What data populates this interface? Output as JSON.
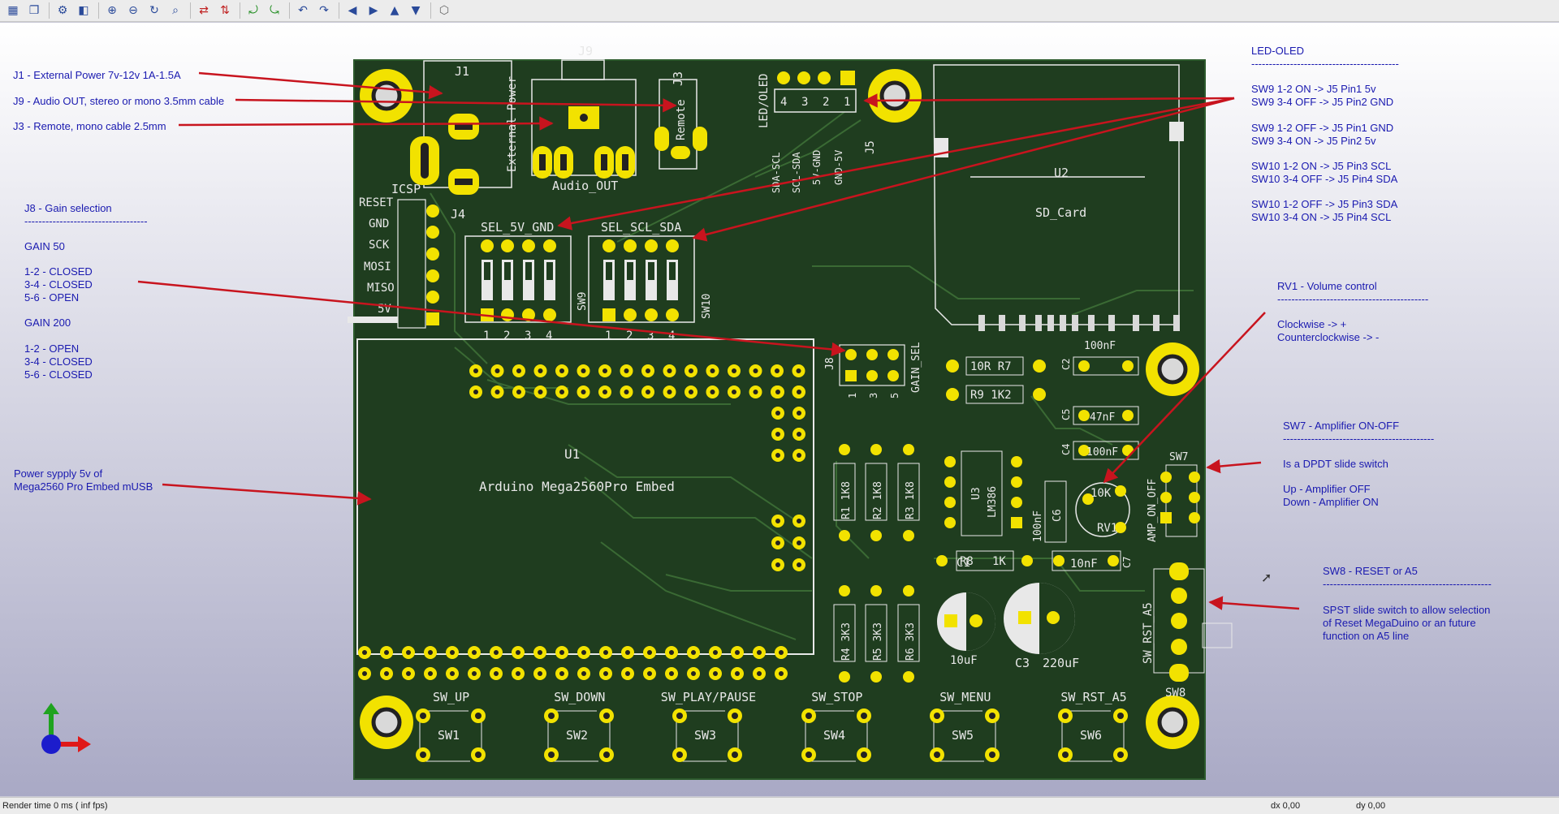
{
  "toolbar": {
    "icons": [
      "board-setup-icon",
      "layers-icon",
      "preferences-icon",
      "3d-box-icon",
      "zoom-in-icon",
      "zoom-out-icon",
      "redraw-icon",
      "zoom-fit-icon",
      "flip-x-icon",
      "flip-y-icon",
      "rotate-x-icon",
      "rotate-y-icon",
      "rotate-z-icon",
      "rotate-z-ccw-icon",
      "move-left-icon",
      "move-right-icon",
      "move-up-icon",
      "move-down-icon",
      "ortho-icon"
    ]
  },
  "annotations": {
    "j1": "J1 - External Power 7v-12v 1A-1.5A",
    "j9": "J9 - Audio OUT, stereo or mono 3.5mm cable",
    "j3": "J3 - Remote, mono cable 2.5mm",
    "j8_title": "J8 - Gain selection",
    "j8_rule": "-----------------------------------",
    "gain50": "GAIN 50",
    "gain50_l1": "1-2 - CLOSED",
    "gain50_l2": "3-4 - CLOSED",
    "gain50_l3": "5-6 - OPEN",
    "gain200": "GAIN 200",
    "gain200_l1": "1-2 - OPEN",
    "gain200_l2": "3-4 - CLOSED",
    "gain200_l3": "5-6 - CLOSED",
    "power_l1": "Power sypply 5v of",
    "power_l2": "Mega2560 Pro Embed mUSB",
    "oled_title": "LED-OLED",
    "oled_rule": "------------------------------------------",
    "oled_l1": "SW9 1-2 ON -> J5 Pin1 5v",
    "oled_l2": "SW9 3-4 OFF -> J5 Pin2 GND",
    "oled_l3": "SW9 1-2 OFF -> J5 Pin1 GND",
    "oled_l4": "SW9 3-4 ON -> J5 Pin2 5v",
    "oled_l5": "SW10 1-2 ON -> J5 Pin3 SCL",
    "oled_l6": "SW10 3-4 OFF -> J5 Pin4 SDA",
    "oled_l7": "SW10 1-2 OFF -> J5 Pin3 SDA",
    "oled_l8": "SW10 3-4 ON -> J5 Pin4 SCL",
    "rv1_title": "RV1 - Volume control",
    "rv1_rule": "-------------------------------------------",
    "rv1_l1": "Clockwise -> +",
    "rv1_l2": "Counterclockwise -> -",
    "sw7_title": "SW7 - Amplifier ON-OFF",
    "sw7_rule": "-------------------------------------------",
    "sw7_l1": "Is a DPDT slide switch",
    "sw7_l2": "Up - Amplifier OFF",
    "sw7_l3": "Down - Amplifier ON",
    "sw8_title": "SW8 - RESET or A5",
    "sw8_rule": "------------------------------------------------",
    "sw8_l1": "SPST slide switch to allow selection",
    "sw8_l2": "of Reset MegaDuino or an future",
    "sw8_l3": "function on A5 line"
  },
  "silkscreen": {
    "j1": "J1",
    "j1_label": "External Power",
    "j9": "J9",
    "j9_label": "Audio_OUT",
    "j3": "J3",
    "j3_label": "Remote",
    "led_oled": "LED/OLED",
    "pin_labels": [
      "SDA-SCL",
      "SCL-SDA",
      "5V-GND",
      "GND-5V"
    ],
    "j5_nums": [
      "4",
      "3",
      "2",
      "1"
    ],
    "j5": "J5",
    "icsp": "ICSP",
    "j4": "J4",
    "icsp_pins": [
      "RESET",
      "GND",
      "SCK",
      "MOSI",
      "MISO",
      "5V"
    ],
    "sel5v": "SEL_5V_GND",
    "selscl": "SEL_SCL_SDA",
    "sw9": "SW9",
    "sw10": "SW10",
    "dip_nums": [
      "1",
      "2",
      "3",
      "4"
    ],
    "u2": "U2",
    "sd_card": "SD_Card",
    "j8": "J8",
    "gain_sel": "GAIN_SEL",
    "j8_nums": [
      "1",
      "3",
      "5"
    ],
    "u1": "U1",
    "mega": "Arduino Mega2560Pro Embed",
    "r7": "10R R7",
    "r9": "R9 1K2",
    "c2": "C2",
    "c2v": "100nF",
    "c5": "C5",
    "c5v": "47nF",
    "c4": "C4",
    "c4v": "100nF",
    "r1": "R1 1K8",
    "r2": "R2 1K8",
    "r3": "R3 1K8",
    "u3": "U3",
    "lm386": "LM386",
    "c6": "C6",
    "c6v": "100nF",
    "rv1": "RV1",
    "rv1v": "10K",
    "sw7": "SW7",
    "amp": "AMP_ON_OFF",
    "r8": "R8",
    "r8v": "1K",
    "c7": "C7",
    "c7v": "10nF",
    "c1": "C1",
    "c1v": "10uF",
    "c3": "C3",
    "c3v": "220uF",
    "r4": "R4 3K3",
    "r5": "R5 3K3",
    "r6": "R6 3K3",
    "swrst": "SW_RST_A5",
    "sw8": "SW8",
    "buttons": [
      {
        "name": "SW_UP",
        "ref": "SW1"
      },
      {
        "name": "SW_DOWN",
        "ref": "SW2"
      },
      {
        "name": "SW_PLAY/PAUSE",
        "ref": "SW3"
      },
      {
        "name": "SW_STOP",
        "ref": "SW4"
      },
      {
        "name": "SW_MENU",
        "ref": "SW5"
      },
      {
        "name": "SW_RST_A5",
        "ref": "SW6"
      }
    ]
  },
  "status": {
    "render": "Render time 0 ms ( inf fps)",
    "dx": "dx 0,00",
    "dy": "dy 0,00"
  },
  "colors": {
    "board": "#1f3d1f",
    "pad": "#f2e200",
    "arrow": "#c8141e",
    "note": "#1a1ab0"
  }
}
